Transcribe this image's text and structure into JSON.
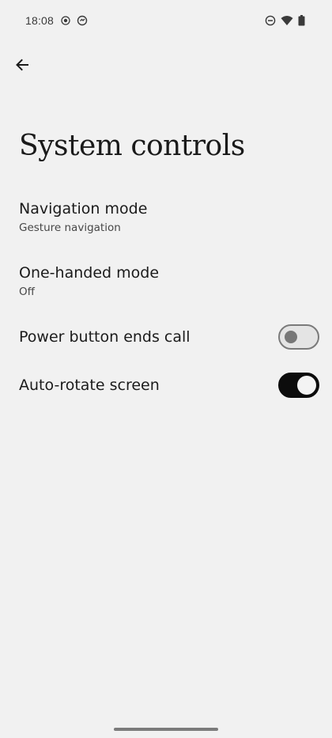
{
  "status_bar": {
    "time": "18:08",
    "left_icons": [
      "screen-record-icon",
      "data-saver-icon"
    ],
    "right_icons": [
      "do-not-disturb-icon",
      "wifi-icon",
      "battery-icon"
    ]
  },
  "header": {
    "back_icon": "arrow-back-icon",
    "title": "System controls"
  },
  "settings": [
    {
      "title": "Navigation mode",
      "summary": "Gesture navigation"
    },
    {
      "title": "One-handed mode",
      "summary": "Off"
    },
    {
      "title": "Power button ends call",
      "toggle": false
    },
    {
      "title": "Auto-rotate screen",
      "toggle": true
    }
  ],
  "colors": {
    "background": "#f1f1f1",
    "text_primary": "#1b1b1b",
    "text_secondary": "#474747",
    "toggle_on_track": "#0c0c0c",
    "toggle_off_track": "#e4e4e4"
  }
}
